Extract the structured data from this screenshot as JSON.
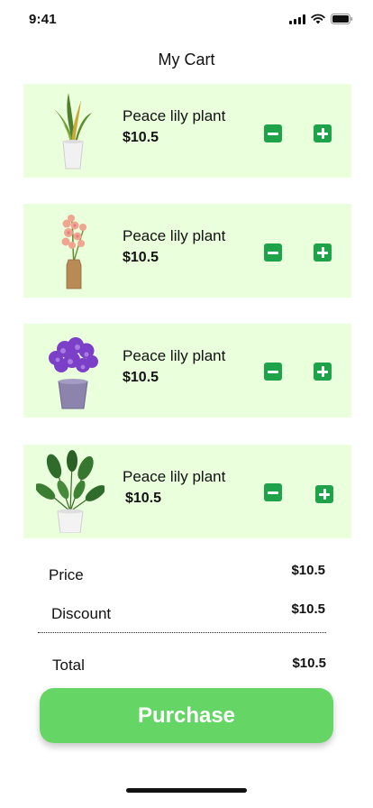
{
  "status_bar": {
    "time": "9:41"
  },
  "page_title": "My Cart",
  "items": [
    {
      "name": "Peace lily plant",
      "price": "$10.5",
      "image_icon": "snake-plant-icon"
    },
    {
      "name": "Peace lily plant",
      "price": "$10.5",
      "image_icon": "orchid-vase-icon"
    },
    {
      "name": "Peace lily plant",
      "price": "$10.5",
      "image_icon": "purple-flower-pot-icon"
    },
    {
      "name": "Peace lily plant",
      "price": "$10.5",
      "image_icon": "bird-of-paradise-plant-icon"
    }
  ],
  "summary": {
    "price_label": "Price",
    "price_value": "$10.5",
    "discount_label": "Discount",
    "discount_value": "$10.5",
    "total_label": "Total",
    "total_value": "$10.5"
  },
  "purchase_label": "Purchase",
  "colors": {
    "item_background": "#eaffdc",
    "quantity_button": "#1fa34a",
    "purchase_button": "#65d565"
  }
}
